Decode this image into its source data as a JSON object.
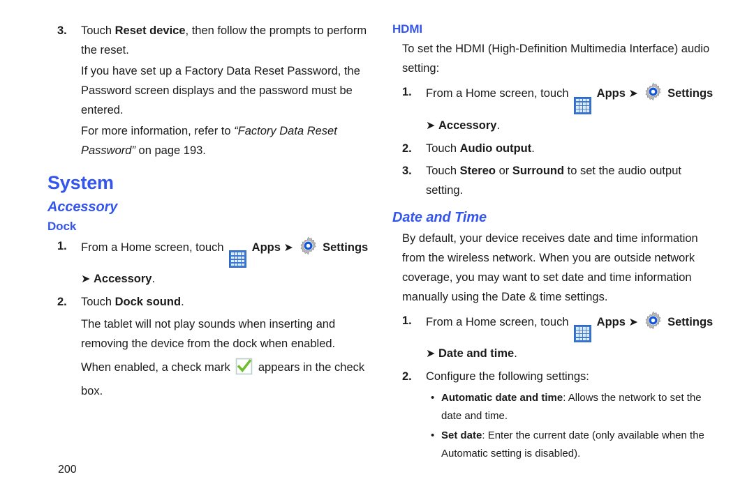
{
  "page": {
    "number": "200",
    "heading_color": "#3355ee",
    "text_color": "#1a1a1a",
    "background": "#ffffff"
  },
  "icons": {
    "apps": "apps-grid-icon",
    "settings": "gear-icon",
    "checkmark": "green-checkmark-icon",
    "arrow": "➜"
  },
  "left_column": {
    "step3": {
      "number": "3.",
      "line1_a": "Touch ",
      "line1_b": "Reset device",
      "line1_c": ", then follow the prompts to perform the reset.",
      "para2": "If you have set up a Factory Data Reset Password, the Password screen displays and the password must be entered.",
      "para3_a": "For more information, refer to ",
      "para3_b": "“Factory Data Reset Password”",
      "para3_c": " on page 193."
    },
    "system_heading": "System",
    "accessory_heading": "Accessory",
    "dock_heading": "Dock",
    "dock_steps": [
      {
        "number": "1.",
        "prefix": "From a Home screen, touch ",
        "apps_label": "Apps",
        "settings_label": "Settings",
        "suffix_arrow": "➜ ",
        "suffix_bold": "Accessory",
        "suffix_tail": "."
      },
      {
        "number": "2.",
        "prefix": "Touch ",
        "bold": "Dock sound",
        "tail": "."
      }
    ],
    "dock_para1": "The tablet will not play sounds when inserting and removing the device from the dock when enabled.",
    "dock_para2_a": "When enabled, a check mark ",
    "dock_para2_b": " appears in the check box."
  },
  "right_column": {
    "hdmi_heading": "HDMI",
    "hdmi_intro": "To set the HDMI (High-Definition Multimedia Interface) audio setting:",
    "hdmi_steps": [
      {
        "number": "1.",
        "prefix": "From a Home screen, touch ",
        "apps_label": "Apps",
        "settings_label": "Settings",
        "suffix_arrow": "➜ ",
        "suffix_bold": "Accessory",
        "suffix_tail": "."
      },
      {
        "number": "2.",
        "prefix": "Touch ",
        "bold": "Audio output",
        "tail": "."
      },
      {
        "number": "3.",
        "prefix": "Touch ",
        "bold1": "Stereo",
        "mid": " or ",
        "bold2": "Surround",
        "tail": " to set the audio output setting."
      }
    ],
    "datetime_heading": "Date and Time",
    "datetime_intro": "By default, your device receives date and time information from the wireless network. When you are outside network coverage, you may want to set date and time information manually using the Date & time settings.",
    "datetime_steps": [
      {
        "number": "1.",
        "prefix": "From a Home screen, touch ",
        "apps_label": "Apps",
        "settings_label": "Settings",
        "suffix_arrow": "➜ ",
        "suffix_bold": "Date and time",
        "suffix_tail": "."
      },
      {
        "number": "2.",
        "text": "Configure the following settings:"
      }
    ],
    "datetime_bullets": [
      {
        "bullet": "•",
        "label": "Automatic date and time",
        "desc": ": Allows the network to set the date and time."
      },
      {
        "bullet": "•",
        "label": "Set date",
        "desc": ": Enter the current date (only available when the Automatic setting is disabled)."
      }
    ]
  }
}
